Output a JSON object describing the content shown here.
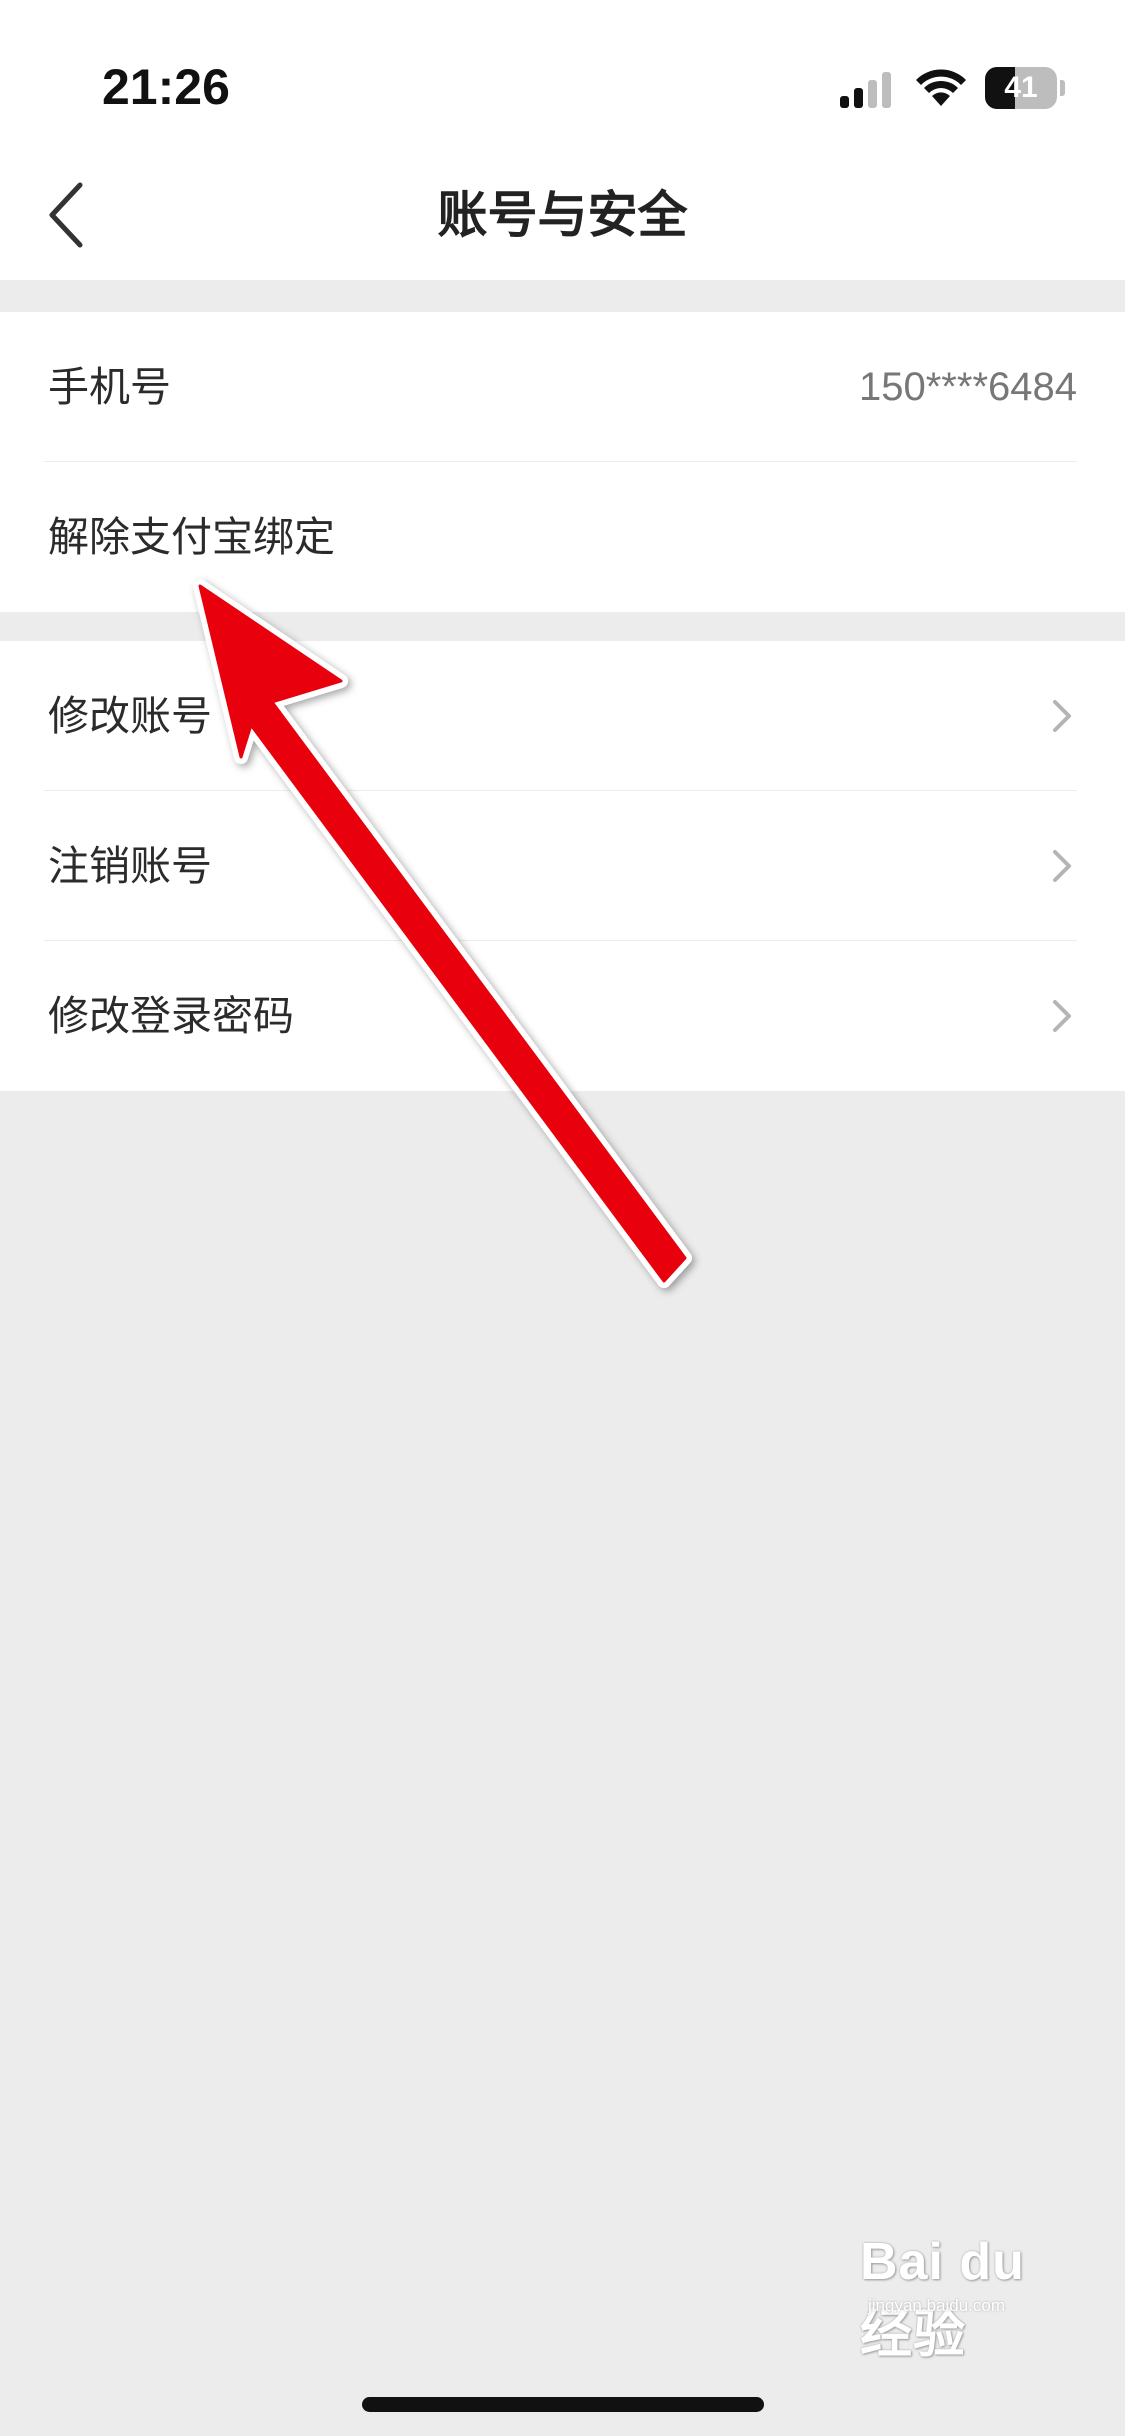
{
  "status_bar": {
    "time": "21:26",
    "battery_level": "41",
    "battery_fraction": 0.41,
    "signal_icon": "cellular-signal-icon",
    "wifi_icon": "wifi-icon"
  },
  "nav": {
    "title": "账号与安全",
    "back_icon": "chevron-left-icon"
  },
  "section_1": {
    "items": [
      {
        "label": "手机号",
        "value": "150****6484"
      },
      {
        "label": "解除支付宝绑定"
      }
    ]
  },
  "section_2": {
    "items": [
      {
        "label": "修改账号",
        "icon": "chevron-right-icon"
      },
      {
        "label": "注销账号",
        "icon": "chevron-right-icon"
      },
      {
        "label": "修改登录密码",
        "icon": "chevron-right-icon"
      }
    ]
  },
  "annotation": {
    "color": "#e8000b"
  },
  "watermark": {
    "text": "Bai du 经验",
    "sub": "jingyan.baidu.com"
  },
  "colors": {
    "background": "#ececec",
    "surface": "#ffffff",
    "text_primary": "#2b2b2b",
    "text_secondary": "#777777",
    "chevron": "#b5b5b5"
  }
}
